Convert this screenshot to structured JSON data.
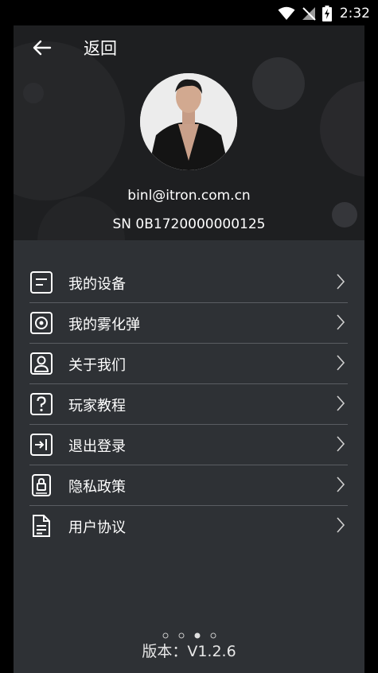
{
  "status_bar": {
    "time": "2:32"
  },
  "header": {
    "back_label": "返回",
    "email": "binl@itron.com.cn",
    "serial": "SN 0B1720000000125"
  },
  "menu": {
    "items": [
      {
        "label": "我的设备",
        "icon": "device-icon"
      },
      {
        "label": "我的雾化弹",
        "icon": "atomizer-icon"
      },
      {
        "label": "关于我们",
        "icon": "about-icon"
      },
      {
        "label": "玩家教程",
        "icon": "help-icon"
      },
      {
        "label": "退出登录",
        "icon": "logout-icon"
      },
      {
        "label": "隐私政策",
        "icon": "privacy-icon"
      },
      {
        "label": "用户协议",
        "icon": "agreement-icon"
      }
    ]
  },
  "footer": {
    "version": "版本：V1.2.6"
  }
}
